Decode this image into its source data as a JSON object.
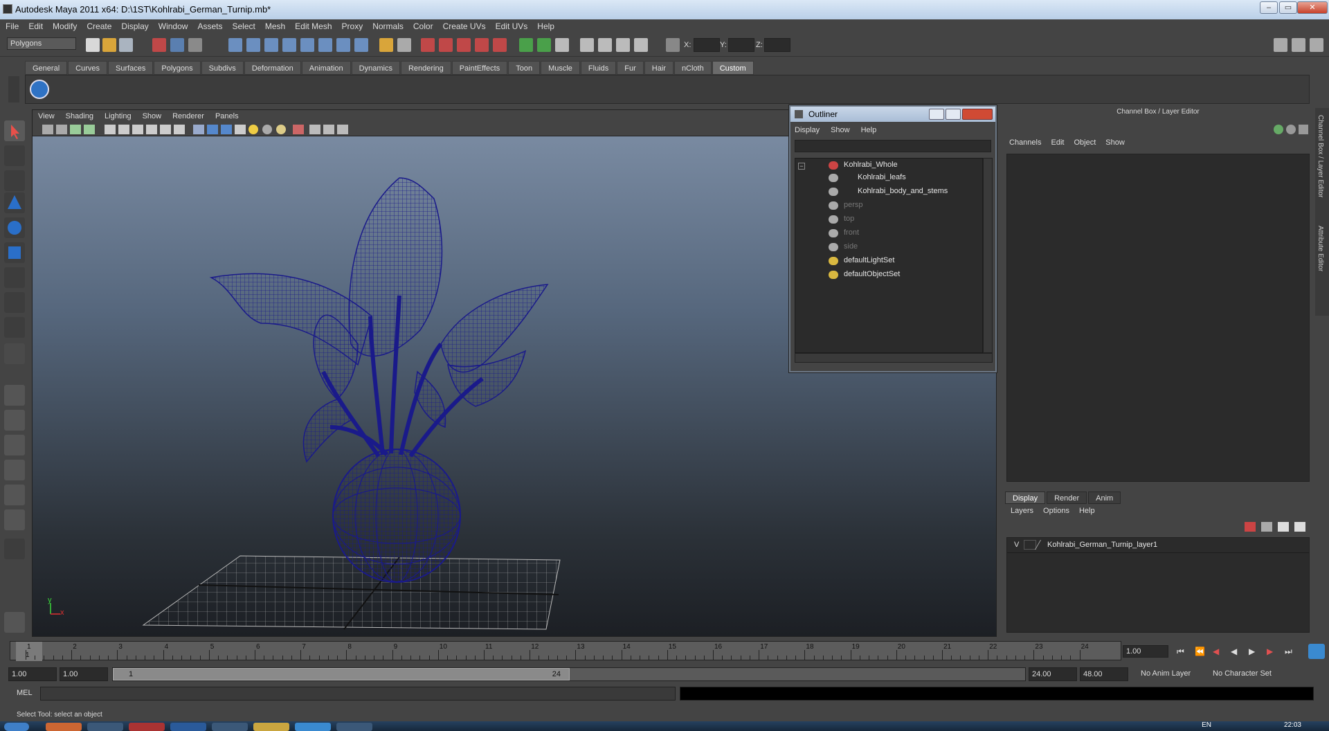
{
  "window": {
    "title": "Autodesk Maya 2011 x64: D:\\1ST\\Kohlrabi_German_Turnip.mb*",
    "minimize": "‒",
    "maximize": "▭",
    "close": "✕"
  },
  "menubar": [
    "File",
    "Edit",
    "Modify",
    "Create",
    "Display",
    "Window",
    "Assets",
    "Select",
    "Mesh",
    "Edit Mesh",
    "Proxy",
    "Normals",
    "Color",
    "Create UVs",
    "Edit UVs",
    "Help"
  ],
  "statusline": {
    "mode": "Polygons",
    "x_label": "X:",
    "y_label": "Y:",
    "z_label": "Z:"
  },
  "shelf_tabs": [
    "General",
    "Curves",
    "Surfaces",
    "Polygons",
    "Subdivs",
    "Deformation",
    "Animation",
    "Dynamics",
    "Rendering",
    "PaintEffects",
    "Toon",
    "Muscle",
    "Fluids",
    "Fur",
    "Hair",
    "nCloth",
    "Custom"
  ],
  "active_shelf": "Custom",
  "viewport": {
    "menu": [
      "View",
      "Shading",
      "Lighting",
      "Show",
      "Renderer",
      "Panels"
    ],
    "axis_y": "y",
    "axis_x": "x"
  },
  "outliner": {
    "title": "Outliner",
    "menu": [
      "Display",
      "Show",
      "Help"
    ],
    "items": [
      {
        "label": "Kohlrabi_Whole",
        "dim": false
      },
      {
        "label": "Kohlrabi_leafs",
        "dim": false
      },
      {
        "label": "Kohlrabi_body_and_stems",
        "dim": false
      },
      {
        "label": "persp",
        "dim": true
      },
      {
        "label": "top",
        "dim": true
      },
      {
        "label": "front",
        "dim": true
      },
      {
        "label": "side",
        "dim": true
      },
      {
        "label": "defaultLightSet",
        "dim": false
      },
      {
        "label": "defaultObjectSet",
        "dim": false
      }
    ]
  },
  "channelbox": {
    "title": "Channel Box / Layer Editor",
    "menu": [
      "Channels",
      "Edit",
      "Object",
      "Show"
    ],
    "layer_tabs": [
      "Display",
      "Render",
      "Anim"
    ],
    "layer_menu": [
      "Layers",
      "Options",
      "Help"
    ],
    "layer": {
      "visibility": "V",
      "name": "Kohlrabi_German_Turnip_layer1"
    }
  },
  "side_tabs": [
    "Channel Box / Layer Editor",
    "Attribute Editor"
  ],
  "timeline": {
    "ticks": [
      "1",
      "2",
      "3",
      "4",
      "5",
      "6",
      "7",
      "8",
      "9",
      "10",
      "11",
      "12",
      "13",
      "14",
      "15",
      "16",
      "17",
      "18",
      "19",
      "20",
      "21",
      "22",
      "23",
      "24"
    ],
    "current_frame_label": "1",
    "current_time": "1.00"
  },
  "range": {
    "start": "1.00",
    "playback_start": "1.00",
    "slider_start": "1",
    "slider_end": "24",
    "playback_end": "24.00",
    "end": "48.00",
    "anim_layer": "No Anim Layer",
    "character_set": "No Character Set"
  },
  "command": {
    "label": "MEL"
  },
  "help": "Select Tool: select an object",
  "taskbar": {
    "lang": "EN",
    "clock": "22:03"
  },
  "colors": {
    "wire": "#1a1a8a",
    "outliner_title": "#b9cbe0"
  }
}
